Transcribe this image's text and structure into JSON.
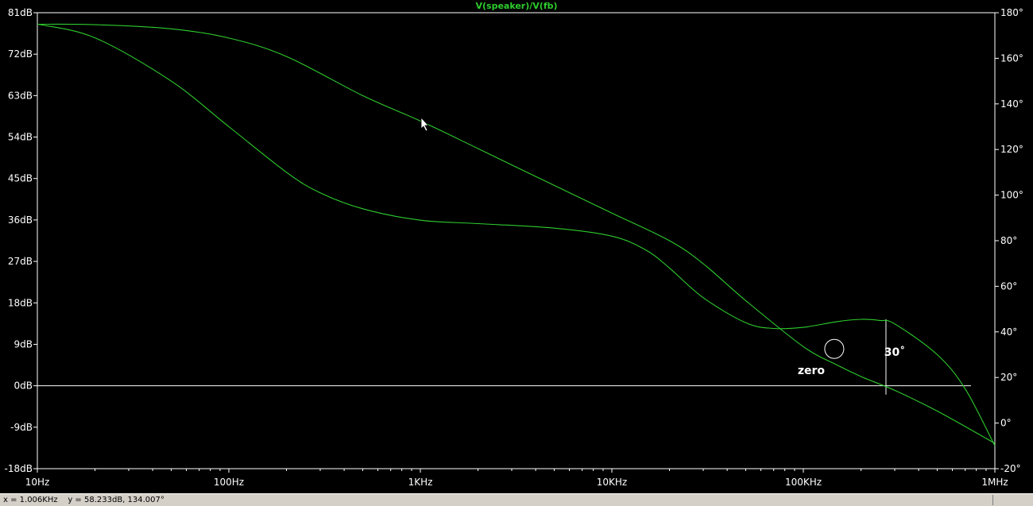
{
  "window": {
    "status_text": "x = 1.006KHz    y = 58.233dB, 134.007°"
  },
  "colors": {
    "background": "#000000",
    "trace": "#2ecc2e",
    "axis": "#ffffff",
    "label": "#ffffff",
    "title": "#2ecc2e",
    "status_bar": "#d4d0c8"
  },
  "chart_data": {
    "type": "line",
    "title": "V(speaker)/V(fb)",
    "x_scale": "log",
    "xlim": [
      10,
      1000000
    ],
    "x_ticks": [
      {
        "value": 10,
        "label": "10Hz"
      },
      {
        "value": 100,
        "label": "100Hz"
      },
      {
        "value": 1000,
        "label": "1KHz"
      },
      {
        "value": 10000,
        "label": "10KHz"
      },
      {
        "value": 100000,
        "label": "100KHz"
      },
      {
        "value": 1000000,
        "label": "1MHz"
      }
    ],
    "y_left": {
      "unit": "dB",
      "ylim": [
        -18,
        81
      ],
      "ticks": [
        {
          "value": 81,
          "label": "81dB"
        },
        {
          "value": 72,
          "label": "72dB"
        },
        {
          "value": 63,
          "label": "63dB"
        },
        {
          "value": 54,
          "label": "54dB"
        },
        {
          "value": 45,
          "label": "45dB"
        },
        {
          "value": 36,
          "label": "36dB"
        },
        {
          "value": 27,
          "label": "27dB"
        },
        {
          "value": 18,
          "label": "18dB"
        },
        {
          "value": 9,
          "label": "9dB"
        },
        {
          "value": 0,
          "label": "0dB"
        },
        {
          "value": -9,
          "label": "-9dB"
        },
        {
          "value": -18,
          "label": "-18dB"
        }
      ]
    },
    "y_right": {
      "unit": "°",
      "ylim": [
        -20,
        180
      ],
      "ticks": [
        {
          "value": 180,
          "label": "180°"
        },
        {
          "value": 160,
          "label": "160°"
        },
        {
          "value": 140,
          "label": "140°"
        },
        {
          "value": 120,
          "label": "120°"
        },
        {
          "value": 100,
          "label": "100°"
        },
        {
          "value": 80,
          "label": "80°"
        },
        {
          "value": 60,
          "label": "60°"
        },
        {
          "value": 40,
          "label": "40°"
        },
        {
          "value": 20,
          "label": "20°"
        },
        {
          "value": 0,
          "label": "0°"
        },
        {
          "value": -20,
          "label": "-20°"
        }
      ]
    },
    "grid": false,
    "series": [
      {
        "axis": "left",
        "x": [
          10,
          20,
          50,
          100,
          200,
          500,
          1000,
          2000,
          5000,
          10000,
          20000,
          30000,
          50000,
          100000,
          150000,
          200000,
          300000,
          500000,
          1000000
        ],
        "values": [
          78.5,
          78.4,
          77.5,
          75.5,
          71.5,
          63,
          57.5,
          51.5,
          43.5,
          37.5,
          31.5,
          26.5,
          18.5,
          8.5,
          4.5,
          2.0,
          -1.0,
          -5.5,
          -12.5
        ]
      },
      {
        "axis": "right",
        "x": [
          10,
          20,
          50,
          100,
          200,
          300,
          500,
          1000,
          2000,
          5000,
          10000,
          15000,
          20000,
          30000,
          50000,
          70000,
          100000,
          150000,
          200000,
          250000,
          300000,
          500000,
          700000,
          1000000
        ],
        "values": [
          175,
          169,
          150,
          130,
          110,
          101,
          94,
          89,
          87.5,
          85.5,
          82,
          76,
          68,
          55,
          44,
          41.5,
          42,
          44.5,
          45.5,
          45,
          43.5,
          30,
          15,
          -10
        ]
      }
    ],
    "annotations": [
      {
        "type": "hline",
        "axis": "left",
        "y": 0,
        "x_from": 10,
        "x_to": 750000
      },
      {
        "type": "vline",
        "x": 270000,
        "y_from_deg": 12.5,
        "y_to_deg": 45.5
      },
      {
        "type": "circle",
        "x": 145000,
        "y": 8.0
      },
      {
        "type": "text",
        "text": "zero",
        "x": 110000,
        "y": 2.5
      },
      {
        "type": "text",
        "text": "30˚",
        "x": 300000,
        "y": 6.5
      }
    ]
  }
}
